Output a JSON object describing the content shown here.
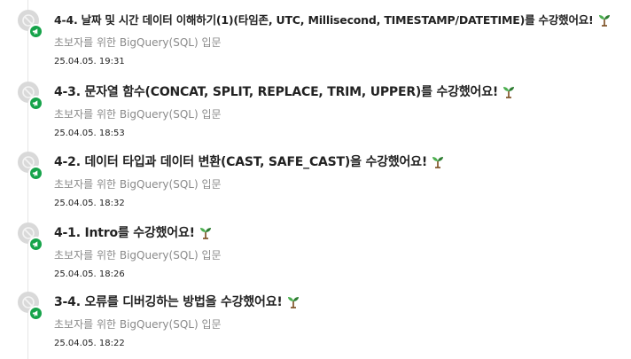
{
  "activities": [
    {
      "title": "4-4. 날짜 및 시간 데이터 이해하기(1)(타임존, UTC, Millisecond, TIMESTAMP/DATETIME)를 수강했어요!",
      "course": "초보자를 위한 BigQuery(SQL) 입문",
      "date": "25.04.05. 19:31"
    },
    {
      "title": "4-3. 문자열 함수(CONCAT, SPLIT, REPLACE, TRIM, UPPER)를 수강했어요!",
      "course": "초보자를 위한 BigQuery(SQL) 입문",
      "date": "25.04.05. 18:53"
    },
    {
      "title": "4-2. 데이터 타입과 데이터 변환(CAST, SAFE_CAST)을 수강했어요!",
      "course": "초보자를 위한 BigQuery(SQL) 입문",
      "date": "25.04.05. 18:32"
    },
    {
      "title": "4-1. Intro를 수강했어요!",
      "course": "초보자를 위한 BigQuery(SQL) 입문",
      "date": "25.04.05. 18:26"
    },
    {
      "title": "3-4. 오류를 디버깅하는 방법을 수강했어요!",
      "course": "초보자를 위한 BigQuery(SQL) 입문",
      "date": "25.04.05. 18:22"
    }
  ],
  "icons": {
    "avatar": "user-avatar-icon",
    "badge": "megaphone-icon",
    "celebration": "sprout-icon"
  },
  "colors": {
    "badge": "#16a34a",
    "avatar": "#d9d9d9",
    "secondary_text": "#8a8a8a"
  }
}
